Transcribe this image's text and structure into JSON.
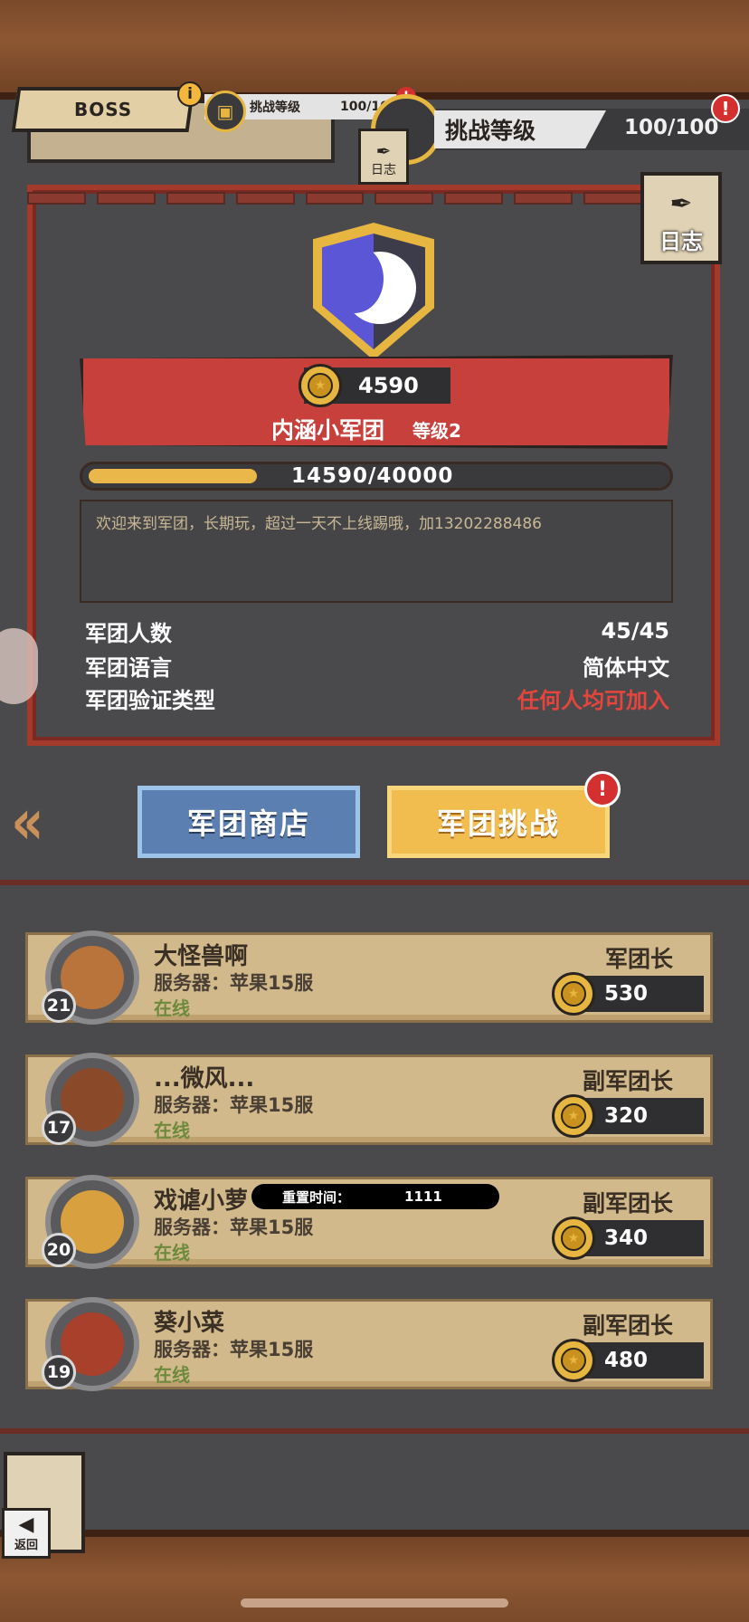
{
  "header": {
    "boss_label": "BOSS",
    "info_icon": "i",
    "mini_challenge_label": "挑战等级",
    "mini_challenge_value": "100/100",
    "challenge_label": "挑战等级",
    "challenge_value": "100/100",
    "alert_icon": "!",
    "log_label": "日志"
  },
  "guild": {
    "score": "4590",
    "name": "内涵小军团",
    "level": "等级2",
    "xp_text": "14590/40000",
    "xp_progress": 0.3648,
    "notice": "欢迎来到军团，长期玩，超过一天不上线踢哦，加13202288486",
    "info": [
      {
        "label": "军团人数",
        "value": "45/45"
      },
      {
        "label": "军团语言",
        "value": "简体中文"
      },
      {
        "label": "军团验证类型",
        "value": "任何人均可加入"
      }
    ]
  },
  "actions": {
    "shop_label": "军团商店",
    "challenge_label": "军团挑战"
  },
  "members": [
    {
      "name": "大怪兽啊",
      "server": "服务器：苹果15服",
      "status": "在线",
      "role": "军团长",
      "coins": "530",
      "level": "21"
    },
    {
      "name": "...微风...",
      "server": "服务器：苹果15服",
      "status": "在线",
      "role": "副军团长",
      "coins": "320",
      "level": "17"
    },
    {
      "name": "戏谑小萝",
      "server": "服务器：苹果15服",
      "status": "在线",
      "role": "副军团长",
      "coins": "340",
      "level": "20"
    },
    {
      "name": "葵小菜",
      "server": "服务器：苹果15服",
      "status": "在线",
      "role": "副军团长",
      "coins": "480",
      "level": "19"
    }
  ],
  "overlay": {
    "reset_label": "重置时间：",
    "reset_value": "1111"
  },
  "footer": {
    "back_label": "返回"
  },
  "colors": {
    "accent_red": "#c8403c",
    "gold": "#e6b640",
    "shop_blue": "#5b7fb0",
    "challenge_yellow": "#f1bd4e",
    "online_green": "#6c8a3c"
  }
}
